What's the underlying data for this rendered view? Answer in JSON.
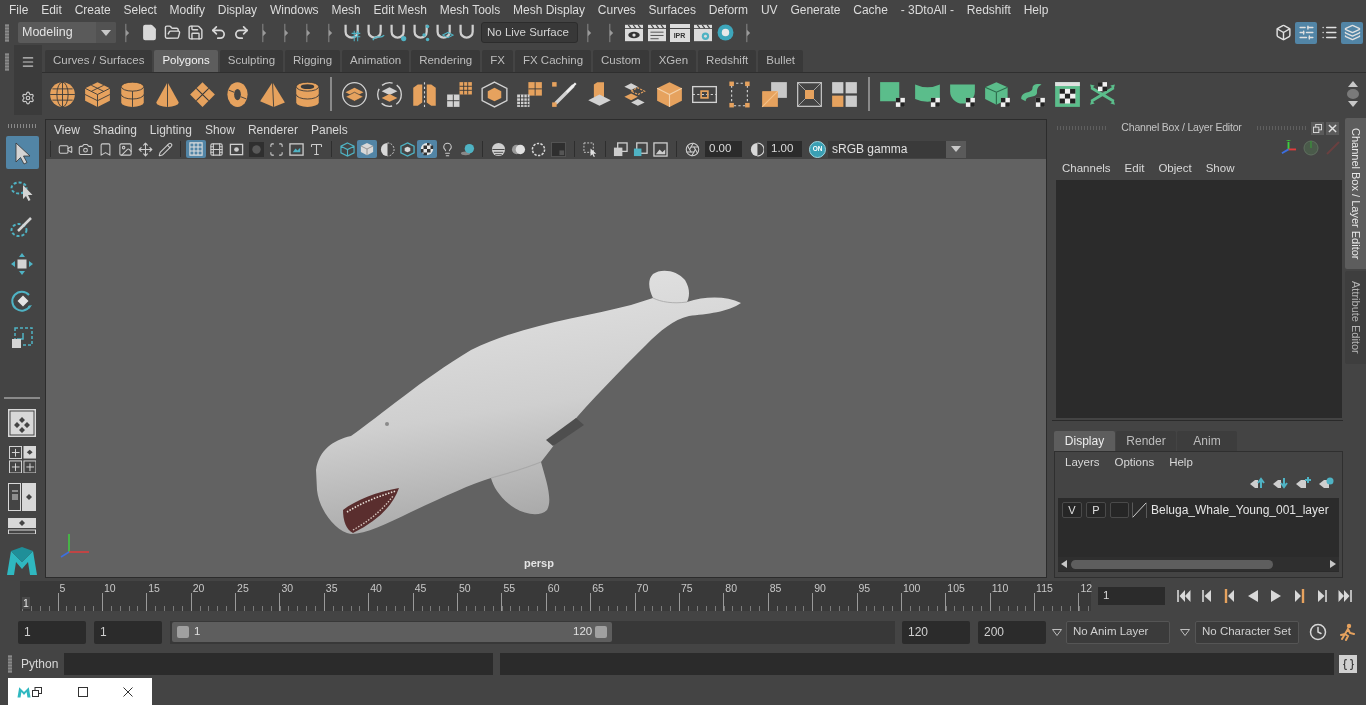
{
  "menu_bar": [
    "File",
    "Edit",
    "Create",
    "Select",
    "Modify",
    "Display",
    "Windows",
    "Mesh",
    "Edit Mesh",
    "Mesh Tools",
    "Mesh Display",
    "Curves",
    "Surfaces",
    "Deform",
    "UV",
    "Generate",
    "Cache",
    "- 3DtoAll -",
    "Redshift",
    "Help"
  ],
  "status_line": {
    "menu_set": "Modeling",
    "live_surface": "No Live Surface",
    "ipr_label": "IPR",
    "panel_toggles": [
      {
        "on": false
      },
      {
        "on": true
      },
      {
        "on": false
      },
      {
        "on": true
      }
    ]
  },
  "shelf": {
    "tabs": [
      {
        "label": "Curves / Surfaces",
        "selected": false
      },
      {
        "label": "Polygons",
        "selected": true
      },
      {
        "label": "Sculpting",
        "selected": false
      },
      {
        "label": "Rigging",
        "selected": false
      },
      {
        "label": "Animation",
        "selected": false
      },
      {
        "label": "Rendering",
        "selected": false
      },
      {
        "label": "FX",
        "selected": false
      },
      {
        "label": "FX Caching",
        "selected": false
      },
      {
        "label": "Custom",
        "selected": false
      },
      {
        "label": "XGen",
        "selected": false
      },
      {
        "label": "Redshift",
        "selected": false
      },
      {
        "label": "Bullet",
        "selected": false
      }
    ]
  },
  "toolbox": {
    "tools": [
      {
        "selected": true
      },
      {
        "selected": false
      },
      {
        "selected": false
      },
      {
        "selected": false
      },
      {
        "selected": false
      },
      {
        "selected": false
      }
    ]
  },
  "viewport": {
    "menu": [
      "View",
      "Shading",
      "Lighting",
      "Show",
      "Renderer",
      "Panels"
    ],
    "grid_on": true,
    "smooth_shade_on": true,
    "textured_on": true,
    "exposure": "0.00",
    "gamma": "1.00",
    "color_management": "ON",
    "color_space": "sRGB gamma",
    "camera": "persp"
  },
  "channel_box": {
    "title": "Channel Box / Layer Editor",
    "menu": [
      "Channels",
      "Edit",
      "Object",
      "Show"
    ]
  },
  "layer_editor": {
    "tabs": [
      {
        "label": "Display",
        "selected": true
      },
      {
        "label": "Render",
        "selected": false
      },
      {
        "label": "Anim",
        "selected": false
      }
    ],
    "menu": [
      "Layers",
      "Options",
      "Help"
    ],
    "layers": [
      {
        "visibility": "V",
        "playback": "P",
        "name": "Beluga_Whale_Young_001_layer"
      }
    ]
  },
  "side_tabs": [
    {
      "label": "Channel Box / Layer Editor",
      "selected": true
    },
    {
      "label": "Attribute Editor",
      "selected": false
    }
  ],
  "timeline": {
    "frame_labels": [
      "5",
      "10",
      "15",
      "20",
      "25",
      "30",
      "35",
      "40",
      "45",
      "50",
      "55",
      "60",
      "65",
      "70",
      "75",
      "80",
      "85",
      "90",
      "95",
      "100",
      "105",
      "110",
      "115",
      "12"
    ],
    "current_frame_marker": "1",
    "level": 0,
    "current_frame": "1"
  },
  "range_slider": {
    "start_frame": "1",
    "playback_start": "1",
    "range_start": "1",
    "range_end": "120",
    "level": 0.61,
    "playback_end": "120",
    "end_frame": "200",
    "anim_layer": "No Anim Layer",
    "character_set": "No Character Set"
  },
  "command_line": {
    "language": "Python"
  }
}
